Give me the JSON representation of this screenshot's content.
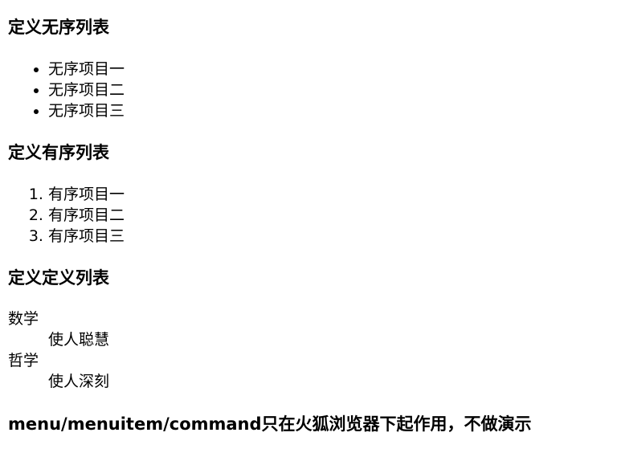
{
  "sections": {
    "unordered": {
      "heading": "定义无序列表",
      "items": [
        "无序项目一",
        "无序项目二",
        "无序项目三"
      ]
    },
    "ordered": {
      "heading": "定义有序列表",
      "items": [
        "有序项目一",
        "有序项目二",
        "有序项目三"
      ]
    },
    "definition": {
      "heading": "定义定义列表",
      "terms": [
        {
          "term": "数学",
          "desc": "使人聪慧"
        },
        {
          "term": "哲学",
          "desc": "使人深刻"
        }
      ]
    },
    "menu_note": {
      "heading": "menu/menuitem/command只在火狐浏览器下起作用，不做演示"
    }
  }
}
